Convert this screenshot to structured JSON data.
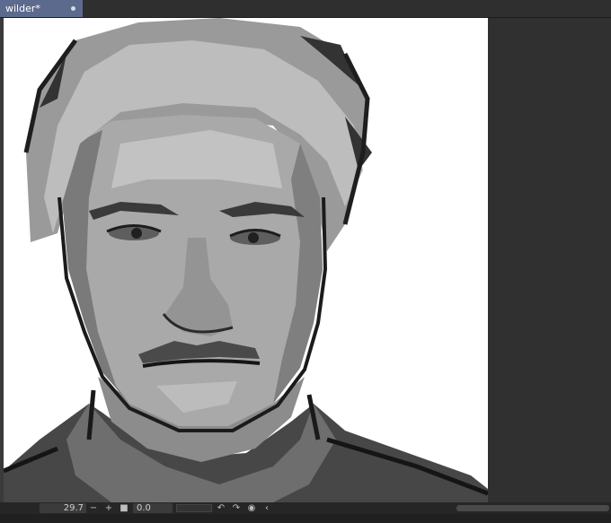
{
  "document_tab": {
    "title": "wilder*"
  },
  "statusbar": {
    "zoom_value": "29.7",
    "zoom_minus": "−",
    "zoom_plus": "+",
    "stop_glyph": "■",
    "angle_value": "0.0",
    "rotate_ccw_glyph": "↶",
    "rotate_cw_glyph": "↷",
    "reset_glyph": "◉",
    "flip_glyph": "‹"
  },
  "icons": [
    "close-dot-icon",
    "stop-icon",
    "rotate-left-icon",
    "rotate-right-icon",
    "reset-rotation-icon",
    "flip-icon"
  ]
}
